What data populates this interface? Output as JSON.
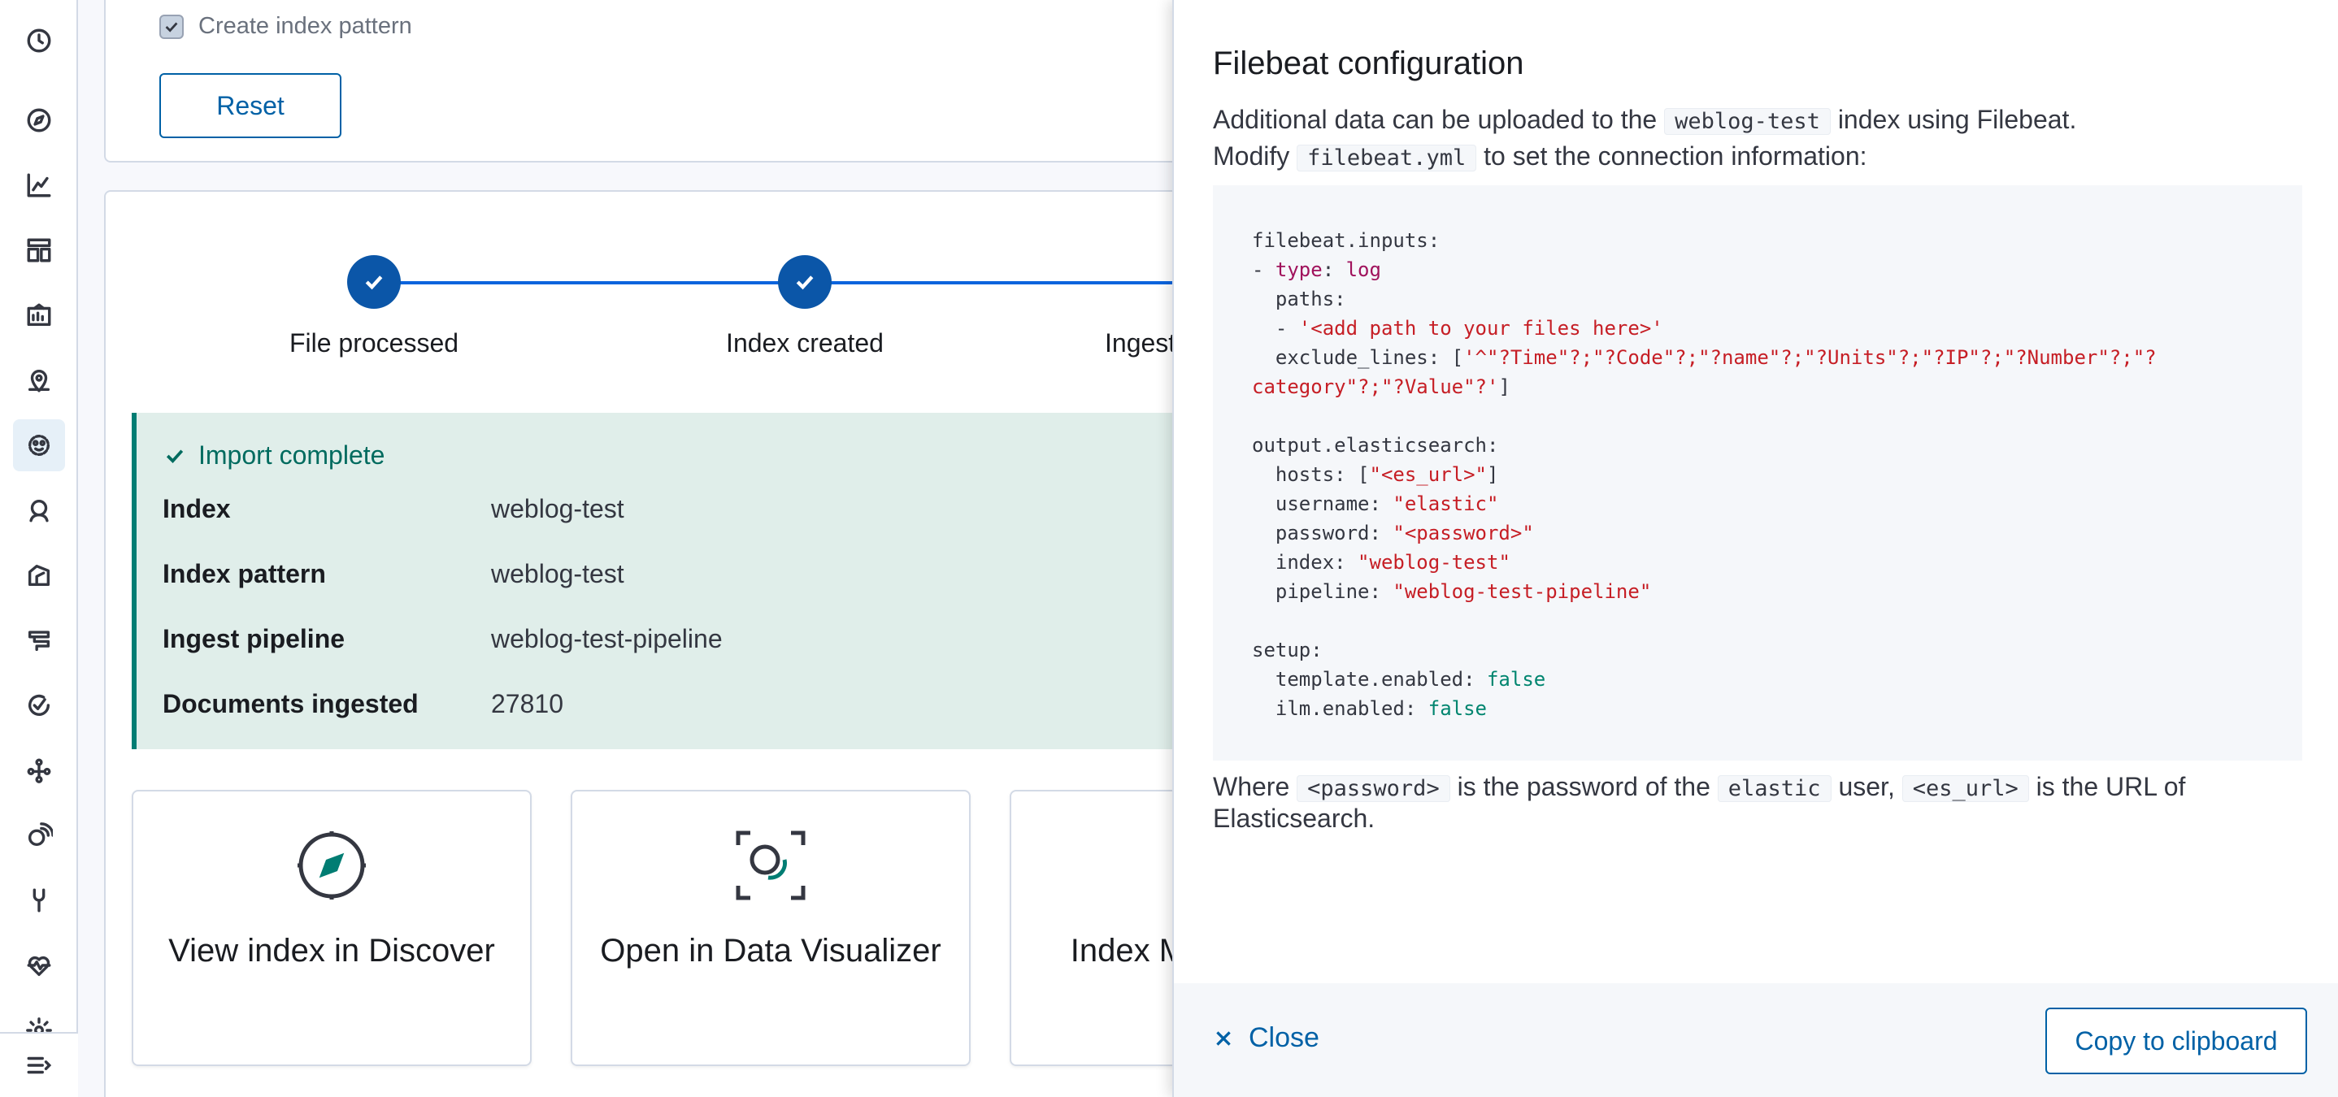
{
  "nav": {
    "icons": [
      "recently-viewed-icon",
      "discover-icon",
      "visualize-icon",
      "dashboard-icon",
      "canvas-icon",
      "maps-icon",
      "machine-learning-icon",
      "metrics-icon",
      "logs-icon",
      "apm-icon",
      "uptime-icon",
      "graph-icon",
      "siem-icon",
      "dev-tools-icon",
      "monitoring-icon",
      "management-icon"
    ],
    "collapse_icon": "menu-collapse-icon"
  },
  "top_panel": {
    "checkbox_label": "Create index pattern",
    "reset_label": "Reset"
  },
  "steps": [
    {
      "label": "File processed",
      "done": true
    },
    {
      "label": "Index created",
      "done": true
    },
    {
      "label": "Ingest pipeline created",
      "done": true
    }
  ],
  "import_status": {
    "title": "Import complete",
    "rows": [
      {
        "label": "Index",
        "value": "weblog-test"
      },
      {
        "label": "Index pattern",
        "value": "weblog-test"
      },
      {
        "label": "Ingest pipeline",
        "value": "weblog-test-pipeline"
      },
      {
        "label": "Documents ingested",
        "value": "27810"
      }
    ]
  },
  "cards": [
    {
      "title": "View index in Discover",
      "icon": "discover-compass-icon"
    },
    {
      "title": "Open in Data Visualizer",
      "icon": "data-visualizer-icon"
    },
    {
      "title": "Index Management",
      "icon": "index-management-icon"
    }
  ],
  "flyout": {
    "title": "Filebeat configuration",
    "desc_part1": "Additional data can be uploaded to the",
    "desc_index": "weblog-test",
    "desc_part2": "index using Filebeat.",
    "desc_part3": "Modify",
    "desc_file": "filebeat.yml",
    "desc_part4": "to set the connection information:",
    "code_lines": {
      "l1": "filebeat.inputs:",
      "l2a": "- ",
      "l2b": "type",
      "l2c": ": ",
      "l2d": "log",
      "l3": "  paths:",
      "l4a": "  - ",
      "l4b": "'<add path to your files here>'",
      "l5a": "  exclude_lines: [",
      "l5b": "'^\"?Time\"?;\"?Code\"?;\"?name\"?;\"?Units\"?;\"?IP\"?;\"?Number\"?;\"?",
      "l6a": "category\"?;\"?Value\"?'",
      "l6b": "]",
      "l8": "output.elasticsearch:",
      "l9a": "  hosts: [",
      "l9b": "\"<es_url>\"",
      "l9c": "]",
      "l10a": "  username: ",
      "l10b": "\"elastic\"",
      "l11a": "  password: ",
      "l11b": "\"<password>\"",
      "l12a": "  index: ",
      "l12b": "\"weblog-test\"",
      "l13a": "  pipeline: ",
      "l13b": "\"weblog-test-pipeline\"",
      "l15": "setup:",
      "l16a": "  template.enabled: ",
      "l16b": "false",
      "l17a": "  ilm.enabled: ",
      "l17b": "false"
    },
    "footer_part1": "Where",
    "footer_password": "<password>",
    "footer_part2": "is the password of the",
    "footer_user": "elastic",
    "footer_part3": "user,",
    "footer_url": "<es_url>",
    "footer_part4": "is the URL of Elasticsearch.",
    "close_label": "Close",
    "copy_label": "Copy to clipboard"
  },
  "colors": {
    "primary": "#0061a6",
    "step": "#0b56a8",
    "success": "#017d73",
    "callout_bg": "#e0eeea",
    "code_keyword": "#a0125c",
    "code_string": "#c61e25",
    "code_boolean": "#00856f"
  }
}
